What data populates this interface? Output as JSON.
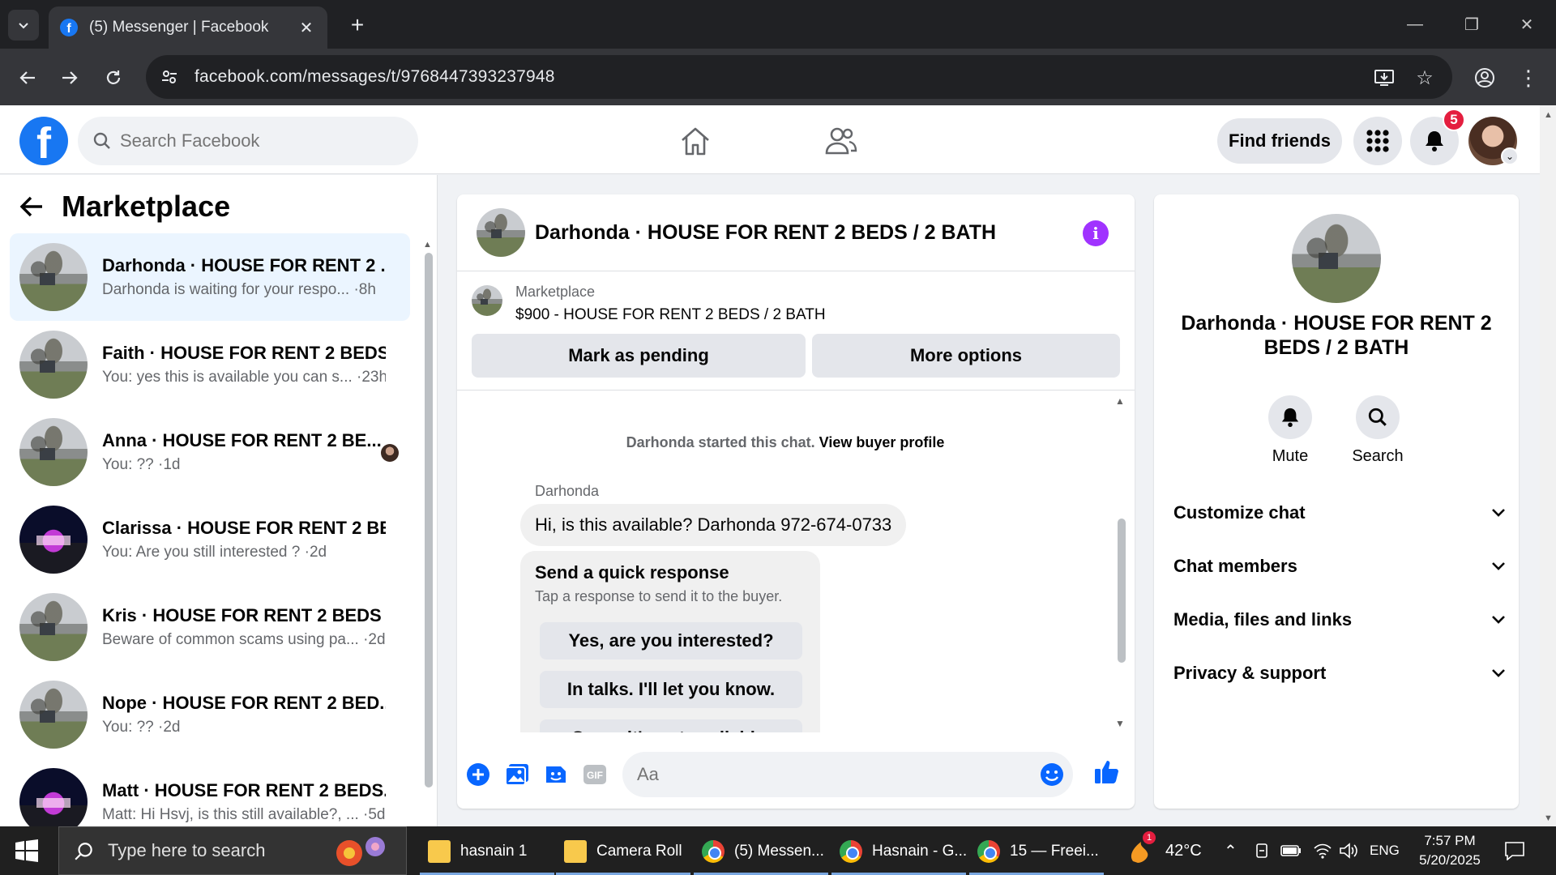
{
  "browser": {
    "tab_title": "(5) Messenger | Facebook",
    "url": "facebook.com/messages/t/9768447393237948"
  },
  "header": {
    "search_placeholder": "Search Facebook",
    "find_friends": "Find friends",
    "notification_count": "5"
  },
  "sidebar": {
    "title": "Marketplace",
    "conversations": [
      {
        "name": "Darhonda · HOUSE FOR RENT 2 ...",
        "preview": "Darhonda is waiting for your respo... ·8h",
        "thumb": "house",
        "active": true
      },
      {
        "name": "Faith · HOUSE FOR RENT 2 BEDS...",
        "preview": "You: yes this is available you can s... ·23h",
        "thumb": "house"
      },
      {
        "name": "Anna · HOUSE FOR RENT 2 BE...",
        "preview": "You: ?? ·1d",
        "thumb": "house",
        "seen": true
      },
      {
        "name": "Clarissa · HOUSE FOR RENT 2 BE...",
        "preview": "You: Are you still interested ? ·2d",
        "thumb": "night"
      },
      {
        "name": "Kris · HOUSE FOR RENT 2 BEDS ...",
        "preview": "Beware of common scams using pa... ·2d",
        "thumb": "house"
      },
      {
        "name": "Nope · HOUSE FOR RENT 2 BED...",
        "preview": "You: ?? ·2d",
        "thumb": "house"
      },
      {
        "name": "Matt · HOUSE FOR RENT 2 BEDS...",
        "preview": "Matt: Hi Hsvj, is this still available?, ... ·5d",
        "thumb": "night"
      }
    ]
  },
  "chat": {
    "title": "Darhonda · HOUSE FOR RENT 2 BEDS / 2 BATH",
    "marketplace_label": "Marketplace",
    "listing": "$900 - HOUSE FOR RENT 2 BEDS / 2 BATH",
    "mark_pending": "Mark as pending",
    "more_options": "More options",
    "started_text": "Darhonda started this chat.",
    "view_profile": "View buyer profile",
    "sender": "Darhonda",
    "message": "Hi, is this available? Darhonda 972-674-0733",
    "quick_title": "Send a quick response",
    "quick_sub": "Tap a response to send it to the buyer.",
    "quick_responses": [
      "Yes, are you interested?",
      "In talks. I'll let you know.",
      "Sorry, it's not available."
    ],
    "composer_placeholder": "Aa"
  },
  "details": {
    "title": "Darhonda · HOUSE FOR RENT 2 BEDS / 2 BATH",
    "mute": "Mute",
    "search": "Search",
    "rows": [
      "Customize chat",
      "Chat members",
      "Media, files and links",
      "Privacy & support"
    ]
  },
  "taskbar": {
    "search_placeholder": "Type here to search",
    "apps": [
      {
        "label": "hasnain 1",
        "icon": "folder"
      },
      {
        "label": "Camera Roll",
        "icon": "folder"
      },
      {
        "label": "(5) Messen...",
        "icon": "chrome"
      },
      {
        "label": "Hasnain - G...",
        "icon": "chrome"
      },
      {
        "label": "15 — Freei...",
        "icon": "chrome"
      }
    ],
    "temperature": "42°C",
    "language": "ENG",
    "time": "7:57 PM",
    "date": "5/20/2025",
    "weather_badge": "1"
  },
  "colors": {
    "facebook_blue": "#1877f2",
    "messenger_purple": "#a033ff",
    "active_conversation": "#ebf5ff",
    "notification_red": "#e41e3f"
  }
}
